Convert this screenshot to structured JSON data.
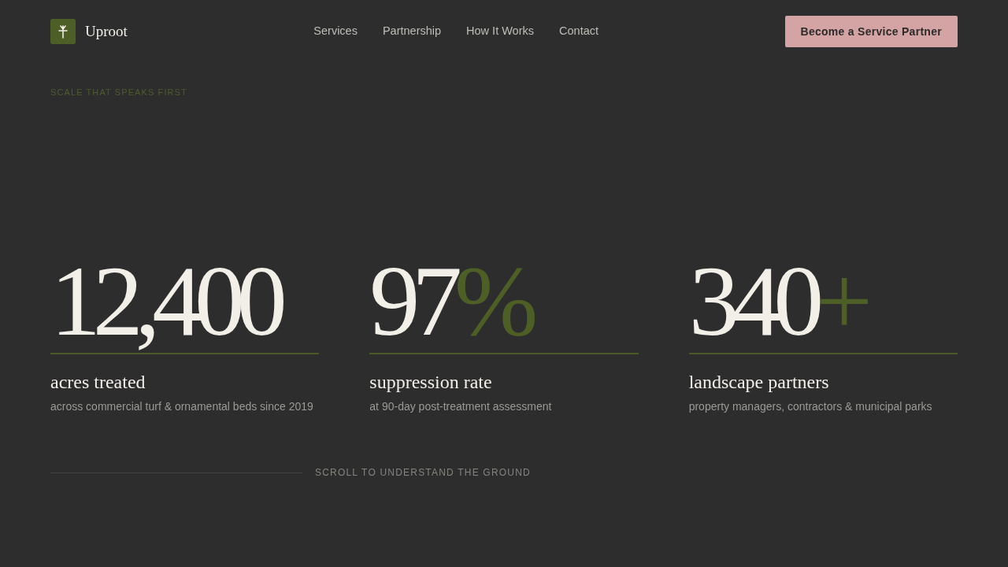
{
  "header": {
    "brand": "Uproot",
    "nav": [
      "Services",
      "Partnership",
      "How It Works",
      "Contact"
    ],
    "cta": "Become a Service Partner"
  },
  "eyebrow": "SCALE THAT SPEAKS FIRST",
  "stats": [
    {
      "value": "12,400",
      "label": "acres treated",
      "detail": "across commercial turf & ornamental beds since 2019"
    },
    {
      "value": "97",
      "suffix": "%",
      "label": "suppression rate",
      "detail": "at 90-day post-treatment assessment"
    },
    {
      "value": "340",
      "suffix": "+",
      "label": "landscape partners",
      "detail": "property managers, contractors & municipal parks"
    }
  ],
  "scroll_hint": "SCROLL TO UNDERSTAND THE GROUND"
}
